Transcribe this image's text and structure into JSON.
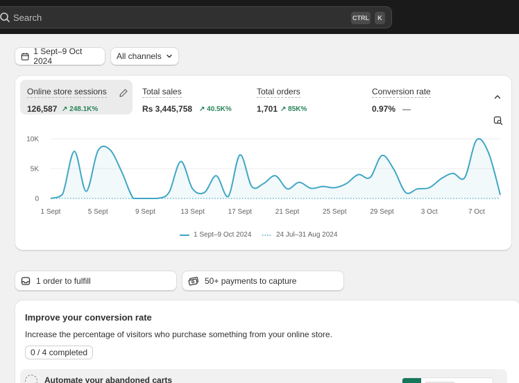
{
  "search": {
    "placeholder": "Search",
    "shortcut_ctrl": "CTRL",
    "shortcut_key": "K"
  },
  "filters": {
    "date_range": "1 Sept–9 Oct 2024",
    "channels": "All channels"
  },
  "metrics": [
    {
      "label": "Online store sessions",
      "value": "126,587",
      "delta": "↗ 248.1K%",
      "selected": true
    },
    {
      "label": "Total sales",
      "value": "Rs 3,445,758",
      "delta": "↗ 40.5K%"
    },
    {
      "label": "Total orders",
      "value": "1,701",
      "delta": "↗ 85K%"
    },
    {
      "label": "Conversion rate",
      "value": "0.97%",
      "delta": "—"
    }
  ],
  "chart_data": {
    "type": "line",
    "y_ticks": [
      "10K",
      "5K",
      "0"
    ],
    "ylim": [
      0,
      10000
    ],
    "x_tick_labels": [
      "1 Sept",
      "5 Sept",
      "9 Sept",
      "13 Sept",
      "17 Sept",
      "21 Sept",
      "25 Sept",
      "29 Sept",
      "3 Oct",
      "7 Oct"
    ],
    "grid": true,
    "series": [
      {
        "name": "1 Sept–9 Oct 2024",
        "color": "#41a7c4",
        "style": "solid",
        "x": [
          "1 Sept",
          "2 Sept",
          "3 Sept",
          "4 Sept",
          "5 Sept",
          "6 Sept",
          "7 Sept",
          "8 Sept",
          "9 Sept",
          "10 Sept",
          "11 Sept",
          "12 Sept",
          "13 Sept",
          "14 Sept",
          "15 Sept",
          "16 Sept",
          "17 Sept",
          "18 Sept",
          "19 Sept",
          "20 Sept",
          "21 Sept",
          "22 Sept",
          "23 Sept",
          "24 Sept",
          "25 Sept",
          "26 Sept",
          "27 Sept",
          "28 Sept",
          "29 Sept",
          "30 Sept",
          "1 Oct",
          "2 Oct",
          "3 Oct",
          "4 Oct",
          "5 Oct",
          "6 Oct",
          "7 Oct",
          "8 Oct",
          "9 Oct"
        ],
        "values": [
          0,
          700,
          7900,
          1200,
          8000,
          8200,
          4500,
          0,
          0,
          0,
          1000,
          6200,
          1600,
          1000,
          3800,
          300,
          7300,
          2000,
          2500,
          3800,
          1600,
          2700,
          1700,
          2000,
          1800,
          2500,
          4000,
          3500,
          7200,
          4900,
          1000,
          1600,
          1800,
          3300,
          4200,
          3500,
          9800,
          7700,
          600
        ]
      },
      {
        "name": "24 Jul–31 Aug 2024",
        "color": "#41a7c4",
        "style": "dotted",
        "values": [
          0,
          0,
          0,
          0,
          0,
          0,
          0,
          0,
          0,
          0,
          0,
          0,
          0,
          0,
          0,
          0,
          0,
          0,
          0,
          0,
          0,
          0,
          0,
          0,
          0,
          0,
          0,
          0,
          0,
          0,
          0,
          0,
          0,
          0,
          0,
          0,
          0,
          0,
          0
        ]
      }
    ]
  },
  "tasks": {
    "orders": "1 order to fulfill",
    "payments": "50+ payments to capture"
  },
  "improve": {
    "title": "Improve your conversion rate",
    "description": "Increase the percentage of visitors who purchase something from your online store.",
    "progress": "0 / 4 completed",
    "first_task": "Automate your abandoned carts"
  }
}
